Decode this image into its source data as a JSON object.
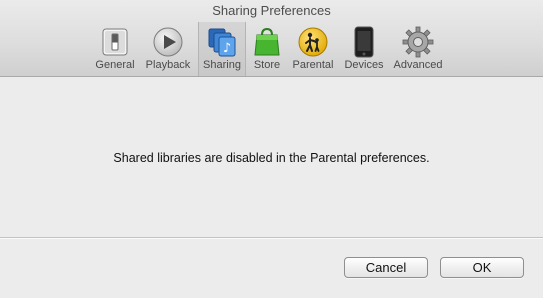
{
  "window": {
    "title": "Sharing Preferences"
  },
  "toolbar": {
    "items": [
      {
        "label": "General",
        "icon": "general-switch-icon"
      },
      {
        "label": "Playback",
        "icon": "playback-icon"
      },
      {
        "label": "Sharing",
        "icon": "sharing-icon",
        "selected": true
      },
      {
        "label": "Store",
        "icon": "store-bag-icon"
      },
      {
        "label": "Parental",
        "icon": "parental-icon"
      },
      {
        "label": "Devices",
        "icon": "devices-phone-icon"
      },
      {
        "label": "Advanced",
        "icon": "advanced-gear-icon"
      }
    ]
  },
  "main": {
    "message": "Shared libraries are disabled in the Parental preferences."
  },
  "buttons": {
    "cancel": "Cancel",
    "ok": "OK"
  }
}
